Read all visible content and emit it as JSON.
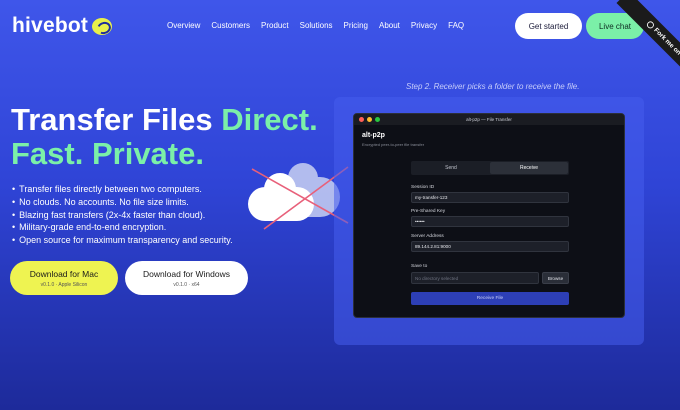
{
  "brand": {
    "name": "hivebot"
  },
  "nav": {
    "items": [
      "Overview",
      "Customers",
      "Product",
      "Solutions",
      "Pricing",
      "About",
      "Privacy",
      "FAQ"
    ],
    "get_started": "Get started",
    "live_chat": "Live chat"
  },
  "ribbon": {
    "label": "Fork me on GitHub",
    "icon": "github-icon"
  },
  "hero": {
    "step_caption": "Step 2. Receiver picks a folder to receive the file.",
    "headline_part1": "Transfer Files ",
    "headline_accent1": "Direct.",
    "headline_accent2": "Fast. Private.",
    "bullets": [
      "Transfer files directly between two computers.",
      "No clouds. No accounts. No file size limits.",
      "Blazing fast transfers (2x-4x faster than cloud).",
      "Military-grade end-to-end encryption.",
      "Open source for maximum transparency and security."
    ],
    "download_mac": {
      "label": "Download for Mac",
      "sub": "v0.1.0 · Apple Silicon"
    },
    "download_windows": {
      "label": "Download for Windows",
      "sub": "v0.1.0 · x64"
    }
  },
  "app": {
    "window_title": "alt-p2p — File Transfer",
    "name": "alt-p2p",
    "description": "Encrypted peer-to-peer file transfer",
    "tabs": [
      "Send",
      "Receive"
    ],
    "active_tab": "Receive",
    "fields": {
      "session_id": {
        "label": "Session ID",
        "value": "my-transfer-123"
      },
      "pre_shared_key": {
        "label": "Pre-Shared Key",
        "value": "••••••"
      },
      "server_address": {
        "label": "Server Address",
        "value": "89.144.2.81:9000"
      },
      "save_to": {
        "label": "Save to",
        "placeholder": "No directory selected"
      }
    },
    "browse": "Browse",
    "receive_button": "Receive File"
  },
  "colors": {
    "background": "#3f56ea",
    "accent_green": "#7bf0a8",
    "accent_yellow": "#eef351",
    "cross_red": "#e8607a"
  }
}
